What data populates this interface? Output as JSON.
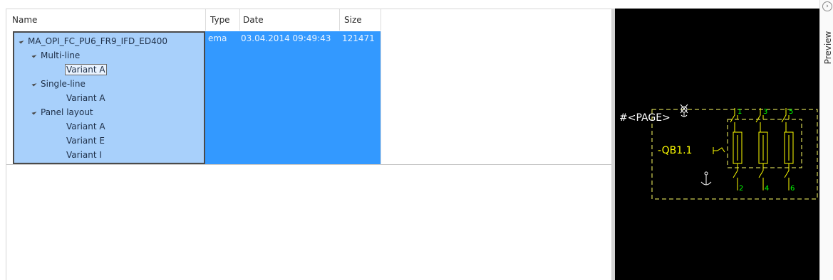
{
  "columns": {
    "name": "Name",
    "type": "Type",
    "date": "Date",
    "size": "Size"
  },
  "file": {
    "name": "MA_OPI_FC_PU6_FR9_IFD_ED400",
    "type": "ema",
    "date": "03.04.2014 09:49:43",
    "size": "121471",
    "tree": [
      {
        "label": "Multi-line",
        "variants": [
          "Variant A"
        ]
      },
      {
        "label": "Single-line",
        "variants": [
          "Variant A"
        ]
      },
      {
        "label": "Panel layout",
        "variants": [
          "Variant A",
          "Variant E",
          "Variant I"
        ]
      }
    ]
  },
  "preview": {
    "tab_label": "Preview",
    "collapse_icon": "chevron-right-icon",
    "page_label": "#<PAGE>",
    "device_label": "-QB1.1",
    "terminals_top": [
      "1",
      "3",
      "5"
    ],
    "terminals_bottom": [
      "2",
      "4",
      "6"
    ],
    "colors": {
      "background": "#000000",
      "symbol": "#ffff00",
      "terminal": "#00ff00",
      "page_text": "#ffffff",
      "selection": "#3399ff",
      "name_cell": "#a8d0fb"
    }
  }
}
